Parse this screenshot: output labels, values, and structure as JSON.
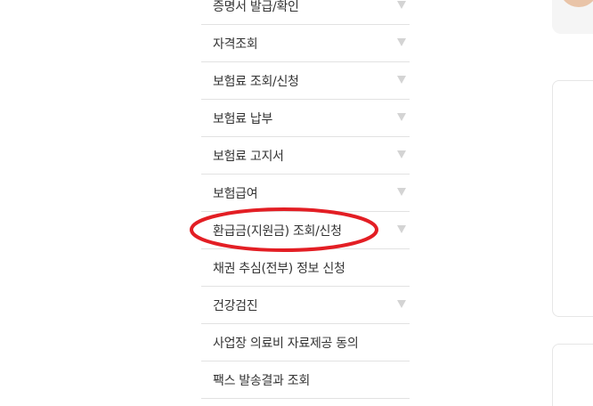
{
  "menu": {
    "items": [
      {
        "label": "증명서 발급/확인",
        "has_arrow": true
      },
      {
        "label": "자격조회",
        "has_arrow": true
      },
      {
        "label": "보험료 조회/신청",
        "has_arrow": true
      },
      {
        "label": "보험료 납부",
        "has_arrow": true
      },
      {
        "label": "보험료 고지서",
        "has_arrow": true
      },
      {
        "label": "보험급여",
        "has_arrow": true
      },
      {
        "label": "환급금(지원금) 조회/신청",
        "has_arrow": true
      },
      {
        "label": "채권 추심(전부) 정보 신청",
        "has_arrow": false
      },
      {
        "label": "건강검진",
        "has_arrow": true
      },
      {
        "label": "사업장 의료비 자료제공 동의",
        "has_arrow": false
      },
      {
        "label": "팩스 발송결과 조회",
        "has_arrow": false
      }
    ]
  },
  "annotation": {
    "highlighted_item": "환급금(지원금) 조회/신청",
    "color": "#e31e24"
  },
  "colors": {
    "text": "#333333",
    "divider": "#e2e2e2",
    "arrow": "#d4d4d4",
    "card_border": "#e6e6e6"
  }
}
